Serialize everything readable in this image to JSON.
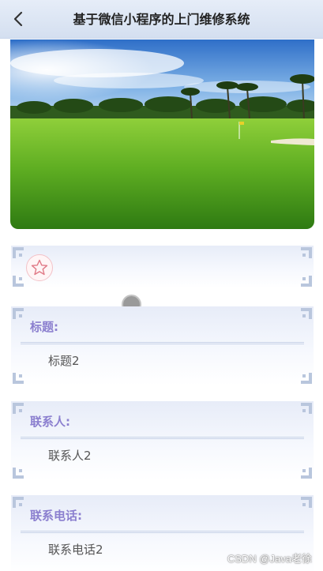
{
  "header": {
    "title": "基于微信小程序的上门维修系统",
    "back_icon": "chevron-left-icon"
  },
  "banner": {
    "image": "golf-course-landscape-photo"
  },
  "favorite": {
    "icon": "star-outline-icon",
    "color": "#e07a87"
  },
  "fields": [
    {
      "label": "标题:",
      "value": "标题2"
    },
    {
      "label": "联系人:",
      "value": "联系人2"
    },
    {
      "label": "联系电话:",
      "value": "联系电话2"
    }
  ],
  "watermark": "CSDN @Java老徐",
  "colors": {
    "nav_bg": "#dde6f4",
    "label_color": "#8b7fcf",
    "corner_color": "#b9c6dd"
  }
}
